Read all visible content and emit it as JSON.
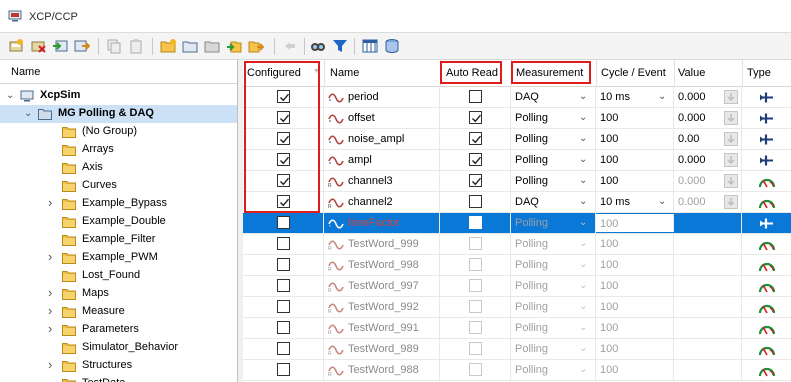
{
  "window": {
    "title": "XCP/CCP"
  },
  "toolbar": {
    "icons": [
      "add-device-icon",
      "remove-device-icon",
      "import-icon",
      "export-icon",
      "copy-icon",
      "paste-icon",
      "new-group-icon",
      "group-icon",
      "group-settings-icon",
      "move-in-icon",
      "move-out-icon",
      "navigate-icon",
      "find-icon",
      "filter-icon",
      "columns-icon",
      "database-icon"
    ]
  },
  "tree": {
    "header": "Name",
    "items": [
      {
        "label": "XcpSim",
        "level": 0,
        "expander": "expanded",
        "icon": "device-icon",
        "bold": true
      },
      {
        "label": "MG Polling & DAQ",
        "level": 1,
        "expander": "expanded",
        "icon": "group-icon",
        "bold": true,
        "selected": true
      },
      {
        "label": "(No Group)",
        "level": 2,
        "expander": "",
        "icon": "folder-icon"
      },
      {
        "label": "Arrays",
        "level": 2,
        "expander": "",
        "icon": "folder-icon"
      },
      {
        "label": "Axis",
        "level": 2,
        "expander": "",
        "icon": "folder-icon"
      },
      {
        "label": "Curves",
        "level": 2,
        "expander": "",
        "icon": "folder-icon"
      },
      {
        "label": "Example_Bypass",
        "level": 2,
        "expander": "collapsed",
        "icon": "folder-icon"
      },
      {
        "label": "Example_Double",
        "level": 2,
        "expander": "",
        "icon": "folder-icon"
      },
      {
        "label": "Example_Filter",
        "level": 2,
        "expander": "",
        "icon": "folder-icon"
      },
      {
        "label": "Example_PWM",
        "level": 2,
        "expander": "collapsed",
        "icon": "folder-icon"
      },
      {
        "label": "Lost_Found",
        "level": 2,
        "expander": "",
        "icon": "folder-icon"
      },
      {
        "label": "Maps",
        "level": 2,
        "expander": "collapsed",
        "icon": "folder-icon"
      },
      {
        "label": "Measure",
        "level": 2,
        "expander": "collapsed",
        "icon": "folder-icon"
      },
      {
        "label": "Parameters",
        "level": 2,
        "expander": "collapsed",
        "icon": "folder-icon"
      },
      {
        "label": "Simulator_Behavior",
        "level": 2,
        "expander": "",
        "icon": "folder-icon"
      },
      {
        "label": "Structures",
        "level": 2,
        "expander": "collapsed",
        "icon": "folder-icon"
      },
      {
        "label": "TestData",
        "level": 2,
        "expander": "",
        "icon": "folder-icon"
      }
    ]
  },
  "grid": {
    "headers": {
      "configured": "Configured",
      "name": "Name",
      "auto_read": "Auto Read",
      "measurement": "Measurement",
      "cycle_event": "Cycle / Event",
      "value": "Value",
      "type": "Type"
    },
    "rows": [
      {
        "configured": true,
        "name": "period",
        "signal": "sine",
        "auto_read": false,
        "measurement": "DAQ",
        "cycle": "10 ms",
        "cycle_dropdown": true,
        "value": "0.000",
        "value_dim": false,
        "type_icon": "ecu-read-icon",
        "state": "normal"
      },
      {
        "configured": true,
        "name": "offset",
        "signal": "sine",
        "auto_read": true,
        "measurement": "Polling",
        "cycle": "100",
        "cycle_dropdown": false,
        "value": "0.000",
        "value_dim": false,
        "type_icon": "ecu-read-icon",
        "state": "normal"
      },
      {
        "configured": true,
        "name": "noise_ampl",
        "signal": "sine",
        "auto_read": true,
        "measurement": "Polling",
        "cycle": "100",
        "cycle_dropdown": false,
        "value": "0.00",
        "value_dim": false,
        "type_icon": "ecu-read-icon",
        "state": "normal"
      },
      {
        "configured": true,
        "name": "ampl",
        "signal": "sine",
        "auto_read": true,
        "measurement": "Polling",
        "cycle": "100",
        "cycle_dropdown": false,
        "value": "0.000",
        "value_dim": false,
        "type_icon": "ecu-read-icon",
        "state": "normal"
      },
      {
        "configured": true,
        "name": "channel3",
        "signal": "ramp",
        "auto_read": true,
        "measurement": "Polling",
        "cycle": "100",
        "cycle_dropdown": false,
        "value": "0.000",
        "value_dim": true,
        "type_icon": "gauge-icon",
        "state": "normal"
      },
      {
        "configured": true,
        "name": "channel2",
        "signal": "ramp",
        "auto_read": false,
        "measurement": "DAQ",
        "cycle": "10 ms",
        "cycle_dropdown": true,
        "value": "0.000",
        "value_dim": true,
        "type_icon": "gauge-icon",
        "state": "normal"
      },
      {
        "configured": false,
        "name": "timeFactor",
        "signal": "sine",
        "auto_read": false,
        "measurement": "Polling",
        "cycle": "100",
        "cycle_dropdown": false,
        "value": "",
        "value_dim": true,
        "type_icon": "ecu-read-icon",
        "state": "selected"
      },
      {
        "configured": false,
        "name": "TestWord_999",
        "signal": "ramp",
        "auto_read": false,
        "measurement": "Polling",
        "cycle": "100",
        "cycle_dropdown": false,
        "value": "",
        "value_dim": true,
        "type_icon": "gauge-icon",
        "state": "dim"
      },
      {
        "configured": false,
        "name": "TestWord_998",
        "signal": "ramp",
        "auto_read": false,
        "measurement": "Polling",
        "cycle": "100",
        "cycle_dropdown": false,
        "value": "",
        "value_dim": true,
        "type_icon": "gauge-icon",
        "state": "dim"
      },
      {
        "configured": false,
        "name": "TestWord_997",
        "signal": "ramp",
        "auto_read": false,
        "measurement": "Polling",
        "cycle": "100",
        "cycle_dropdown": false,
        "value": "",
        "value_dim": true,
        "type_icon": "gauge-icon",
        "state": "dim"
      },
      {
        "configured": false,
        "name": "TestWord_992",
        "signal": "ramp",
        "auto_read": false,
        "measurement": "Polling",
        "cycle": "100",
        "cycle_dropdown": false,
        "value": "",
        "value_dim": true,
        "type_icon": "gauge-icon",
        "state": "dim"
      },
      {
        "configured": false,
        "name": "TestWord_991",
        "signal": "ramp",
        "auto_read": false,
        "measurement": "Polling",
        "cycle": "100",
        "cycle_dropdown": false,
        "value": "",
        "value_dim": true,
        "type_icon": "gauge-icon",
        "state": "dim"
      },
      {
        "configured": false,
        "name": "TestWord_989",
        "signal": "ramp",
        "auto_read": false,
        "measurement": "Polling",
        "cycle": "100",
        "cycle_dropdown": false,
        "value": "",
        "value_dim": true,
        "type_icon": "gauge-icon",
        "state": "dim"
      },
      {
        "configured": false,
        "name": "TestWord_988",
        "signal": "ramp",
        "auto_read": false,
        "measurement": "Polling",
        "cycle": "100",
        "cycle_dropdown": false,
        "value": "",
        "value_dim": true,
        "type_icon": "gauge-icon",
        "state": "dim"
      }
    ]
  },
  "colors": {
    "selection": "#0a78d7",
    "tree_selection": "#cce0f6",
    "highlight_box": "#e01b1b",
    "signal": "#b2413b"
  }
}
